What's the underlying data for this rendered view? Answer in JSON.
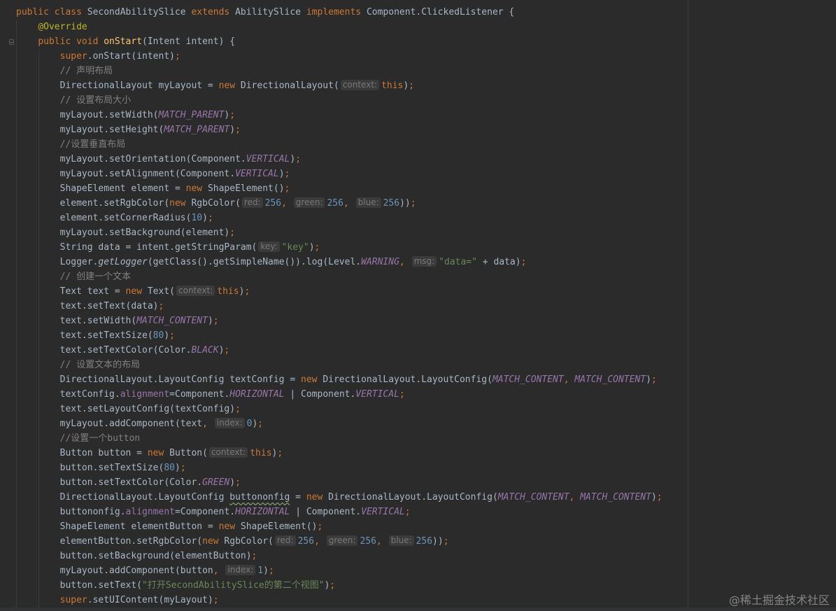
{
  "editor": {
    "theme_colors": {
      "background": "#2b2b2b",
      "text": "#a9b7c6",
      "keyword": "#cc7832",
      "annotation": "#bbb529",
      "method_declaration": "#ffc66d",
      "number": "#6897bb",
      "string": "#6a8759",
      "comment": "#808080",
      "constant": "#9876aa"
    },
    "lines": [
      [
        {
          "t": "public class ",
          "c": "kw"
        },
        {
          "t": "SecondAbilitySlice "
        },
        {
          "t": "extends ",
          "c": "kw"
        },
        {
          "t": "AbilitySlice "
        },
        {
          "t": "implements ",
          "c": "kw"
        },
        {
          "t": "Component.ClickedListener {"
        }
      ],
      [
        {
          "t": "    "
        },
        {
          "t": "@Override",
          "c": "ann"
        }
      ],
      [
        {
          "t": "    "
        },
        {
          "t": "public void ",
          "c": "kw"
        },
        {
          "t": "onStart",
          "c": "fn"
        },
        {
          "t": "(Intent intent) {"
        }
      ],
      [
        {
          "t": "        "
        },
        {
          "t": "super",
          "c": "kw"
        },
        {
          "t": ".onStart(intent)"
        },
        {
          "t": ";",
          "c": "kw"
        }
      ],
      [
        {
          "t": "        "
        },
        {
          "t": "// 声明布局",
          "c": "cm"
        }
      ],
      [
        {
          "t": "        DirectionalLayout myLayout = "
        },
        {
          "t": "new ",
          "c": "kw"
        },
        {
          "t": "DirectionalLayout("
        },
        {
          "t": "context:",
          "h": true
        },
        {
          "t": "this",
          "c": "kw"
        },
        {
          "t": ")"
        },
        {
          "t": ";",
          "c": "kw"
        }
      ],
      [
        {
          "t": "        "
        },
        {
          "t": "// 设置布局大小",
          "c": "cm"
        }
      ],
      [
        {
          "t": "        myLayout.setWidth("
        },
        {
          "t": "MATCH_PARENT",
          "c": "cst"
        },
        {
          "t": ")"
        },
        {
          "t": ";",
          "c": "kw"
        }
      ],
      [
        {
          "t": "        myLayout.setHeight("
        },
        {
          "t": "MATCH_PARENT",
          "c": "cst"
        },
        {
          "t": ")"
        },
        {
          "t": ";",
          "c": "kw"
        }
      ],
      [
        {
          "t": "        "
        },
        {
          "t": "//设置垂直布局",
          "c": "cm"
        }
      ],
      [
        {
          "t": "        myLayout.setOrientation(Component."
        },
        {
          "t": "VERTICAL",
          "c": "cst"
        },
        {
          "t": ")"
        },
        {
          "t": ";",
          "c": "kw"
        }
      ],
      [
        {
          "t": "        myLayout.setAlignment(Component."
        },
        {
          "t": "VERTICAL",
          "c": "cst"
        },
        {
          "t": ")"
        },
        {
          "t": ";",
          "c": "kw"
        }
      ],
      [
        {
          "t": "        ShapeElement element = "
        },
        {
          "t": "new ",
          "c": "kw"
        },
        {
          "t": "ShapeElement()"
        },
        {
          "t": ";",
          "c": "kw"
        }
      ],
      [
        {
          "t": "        element.setRgbColor("
        },
        {
          "t": "new ",
          "c": "kw"
        },
        {
          "t": "RgbColor("
        },
        {
          "t": "red:",
          "h": true
        },
        {
          "t": "256",
          "c": "num"
        },
        {
          "t": ", ",
          "c": "kw"
        },
        {
          "t": "green:",
          "h": true
        },
        {
          "t": "256",
          "c": "num"
        },
        {
          "t": ", ",
          "c": "kw"
        },
        {
          "t": "blue:",
          "h": true
        },
        {
          "t": "256",
          "c": "num"
        },
        {
          "t": "))"
        },
        {
          "t": ";",
          "c": "kw"
        }
      ],
      [
        {
          "t": "        element.setCornerRadius("
        },
        {
          "t": "10",
          "c": "num"
        },
        {
          "t": ")"
        },
        {
          "t": ";",
          "c": "kw"
        }
      ],
      [
        {
          "t": "        myLayout.setBackground(element)"
        },
        {
          "t": ";",
          "c": "kw"
        }
      ],
      [
        {
          "t": "        String data = intent.getStringParam("
        },
        {
          "t": "key:",
          "h": true
        },
        {
          "t": "\"key\"",
          "c": "str"
        },
        {
          "t": ")"
        },
        {
          "t": ";",
          "c": "kw"
        }
      ],
      [
        {
          "t": "        Logger."
        },
        {
          "t": "getLogger",
          "c": "ital"
        },
        {
          "t": "(getClass().getSimpleName()).log(Level."
        },
        {
          "t": "WARNING",
          "c": "cst"
        },
        {
          "t": ", ",
          "c": "kw"
        },
        {
          "t": "msg:",
          "h": true
        },
        {
          "t": "\"data=\"",
          "c": "str"
        },
        {
          "t": " + data)"
        },
        {
          "t": ";",
          "c": "kw"
        }
      ],
      [
        {
          "t": "        "
        },
        {
          "t": "// 创建一个文本",
          "c": "cm"
        }
      ],
      [
        {
          "t": "        Text text = "
        },
        {
          "t": "new ",
          "c": "kw"
        },
        {
          "t": "Text("
        },
        {
          "t": "context:",
          "h": true
        },
        {
          "t": "this",
          "c": "kw"
        },
        {
          "t": ")"
        },
        {
          "t": ";",
          "c": "kw"
        }
      ],
      [
        {
          "t": "        text.setText(data)"
        },
        {
          "t": ";",
          "c": "kw"
        }
      ],
      [
        {
          "t": "        text.setWidth("
        },
        {
          "t": "MATCH_CONTENT",
          "c": "cst"
        },
        {
          "t": ")"
        },
        {
          "t": ";",
          "c": "kw"
        }
      ],
      [
        {
          "t": "        text.setTextSize("
        },
        {
          "t": "80",
          "c": "num"
        },
        {
          "t": ")"
        },
        {
          "t": ";",
          "c": "kw"
        }
      ],
      [
        {
          "t": "        text.setTextColor(Color."
        },
        {
          "t": "BLACK",
          "c": "cst"
        },
        {
          "t": ")"
        },
        {
          "t": ";",
          "c": "kw"
        }
      ],
      [
        {
          "t": "        "
        },
        {
          "t": "// 设置文本的布局",
          "c": "cm"
        }
      ],
      [
        {
          "t": "        DirectionalLayout.LayoutConfig textConfig = "
        },
        {
          "t": "new ",
          "c": "kw"
        },
        {
          "t": "DirectionalLayout.LayoutConfig("
        },
        {
          "t": "MATCH_CONTENT",
          "c": "cst"
        },
        {
          "t": ", ",
          "c": "kw"
        },
        {
          "t": "MATCH_CONTENT",
          "c": "cst"
        },
        {
          "t": ")"
        },
        {
          "t": ";",
          "c": "kw"
        }
      ],
      [
        {
          "t": "        textConfig."
        },
        {
          "t": "alignment",
          "c": "fld"
        },
        {
          "t": "=Component."
        },
        {
          "t": "HORIZONTAL",
          "c": "cst"
        },
        {
          "t": " | Component."
        },
        {
          "t": "VERTICAL",
          "c": "cst"
        },
        {
          "t": ";",
          "c": "kw"
        }
      ],
      [
        {
          "t": "        text.setLayoutConfig(textConfig)"
        },
        {
          "t": ";",
          "c": "kw"
        }
      ],
      [
        {
          "t": "        myLayout.addComponent(text"
        },
        {
          "t": ", ",
          "c": "kw"
        },
        {
          "t": "index:",
          "h": true
        },
        {
          "t": "0",
          "c": "num"
        },
        {
          "t": ")"
        },
        {
          "t": ";",
          "c": "kw"
        }
      ],
      [
        {
          "t": "        "
        },
        {
          "t": "//设置一个button",
          "c": "cm"
        }
      ],
      [
        {
          "t": "        Button button = "
        },
        {
          "t": "new ",
          "c": "kw"
        },
        {
          "t": "Button("
        },
        {
          "t": "context:",
          "h": true
        },
        {
          "t": "this",
          "c": "kw"
        },
        {
          "t": ")"
        },
        {
          "t": ";",
          "c": "kw"
        }
      ],
      [
        {
          "t": "        button.setTextSize("
        },
        {
          "t": "80",
          "c": "num"
        },
        {
          "t": ")"
        },
        {
          "t": ";",
          "c": "kw"
        }
      ],
      [
        {
          "t": "        button.setTextColor(Color."
        },
        {
          "t": "GREEN",
          "c": "cst"
        },
        {
          "t": ")"
        },
        {
          "t": ";",
          "c": "kw"
        }
      ],
      [
        {
          "t": "        DirectionalLayout.LayoutConfig "
        },
        {
          "t": "buttononfig",
          "c": "wavy"
        },
        {
          "t": " = "
        },
        {
          "t": "new ",
          "c": "kw"
        },
        {
          "t": "DirectionalLayout.LayoutConfig("
        },
        {
          "t": "MATCH_CONTENT",
          "c": "cst"
        },
        {
          "t": ", ",
          "c": "kw"
        },
        {
          "t": "MATCH_CONTENT",
          "c": "cst"
        },
        {
          "t": ")"
        },
        {
          "t": ";",
          "c": "kw"
        }
      ],
      [
        {
          "t": "        buttononfig."
        },
        {
          "t": "alignment",
          "c": "fld"
        },
        {
          "t": "=Component."
        },
        {
          "t": "HORIZONTAL",
          "c": "cst"
        },
        {
          "t": " | Component."
        },
        {
          "t": "VERTICAL",
          "c": "cst"
        },
        {
          "t": ";",
          "c": "kw"
        }
      ],
      [
        {
          "t": "        ShapeElement elementButton = "
        },
        {
          "t": "new ",
          "c": "kw"
        },
        {
          "t": "ShapeElement()"
        },
        {
          "t": ";",
          "c": "kw"
        }
      ],
      [
        {
          "t": "        elementButton.setRgbColor("
        },
        {
          "t": "new ",
          "c": "kw"
        },
        {
          "t": "RgbColor("
        },
        {
          "t": "red:",
          "h": true
        },
        {
          "t": "256",
          "c": "num"
        },
        {
          "t": ", ",
          "c": "kw"
        },
        {
          "t": "green:",
          "h": true
        },
        {
          "t": "256",
          "c": "num"
        },
        {
          "t": ", ",
          "c": "kw"
        },
        {
          "t": "blue:",
          "h": true
        },
        {
          "t": "256",
          "c": "num"
        },
        {
          "t": "))"
        },
        {
          "t": ";",
          "c": "kw"
        }
      ],
      [
        {
          "t": "        button.setBackground(elementButton)"
        },
        {
          "t": ";",
          "c": "kw"
        }
      ],
      [
        {
          "t": "        myLayout.addComponent(button"
        },
        {
          "t": ", ",
          "c": "kw"
        },
        {
          "t": "index:",
          "h": true
        },
        {
          "t": "1",
          "c": "num"
        },
        {
          "t": ")"
        },
        {
          "t": ";",
          "c": "kw"
        }
      ],
      [
        {
          "t": "        button.setText("
        },
        {
          "t": "\"打开SecondAbilitySlice的第二个视图\"",
          "c": "str"
        },
        {
          "t": ")"
        },
        {
          "t": ";",
          "c": "kw"
        }
      ],
      [
        {
          "t": "        "
        },
        {
          "t": "super",
          "c": "kw"
        },
        {
          "t": ".setUIContent(myLayout)"
        },
        {
          "t": ";",
          "c": "kw"
        }
      ]
    ]
  },
  "watermark": {
    "text": "@稀土掘金技术社区"
  }
}
